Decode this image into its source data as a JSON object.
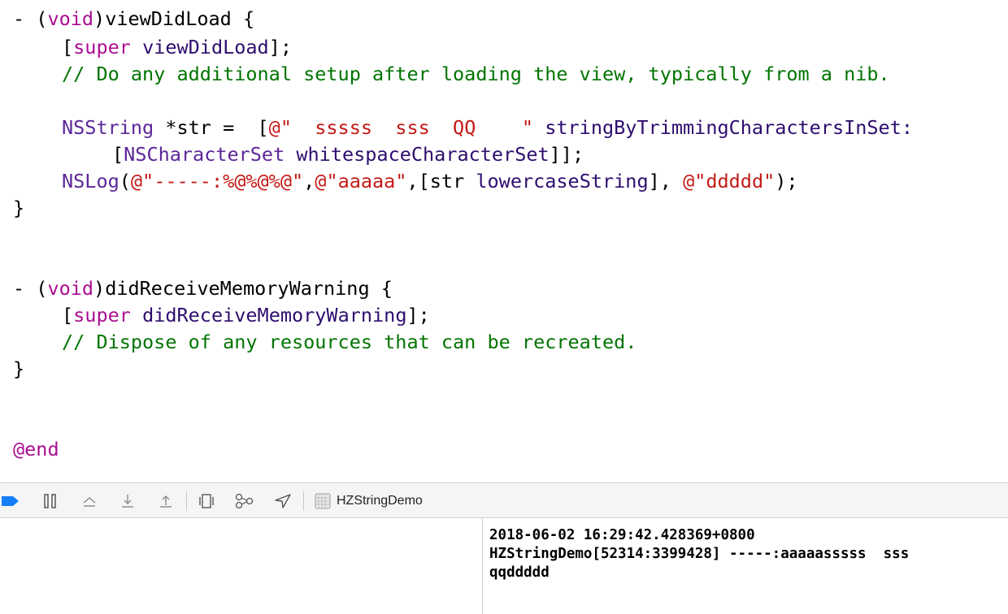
{
  "editor": {
    "viewDidLoad": {
      "sig_dash": "- (",
      "sig_void": "void",
      "sig_name": ")viewDidLoad {",
      "super_open": "[",
      "super_kw": "super",
      "super_call": "viewDidLoad",
      "super_close": "];",
      "comment": "// Do any additional setup after loading the view, typically from a nib.",
      "str_type": "NSString",
      "str_var": " *str =  [",
      "str_literal": "@\"  sssss  sss  QQ    \"",
      "str_sel": " stringByTrimmingCharactersInSet:",
      "cs_open": "[",
      "cs_class": "NSCharacterSet",
      "cs_sel": "whitespaceCharacterSet",
      "cs_close": "]];",
      "log_fn": "NSLog",
      "log_open": "(",
      "log_fmt": "@\"-----:%@%@%@\"",
      "log_comma1": ",",
      "log_arg1": "@\"aaaaa\"",
      "log_comma2": ",[str ",
      "log_sel": "lowercaseString",
      "log_comma3": "], ",
      "log_arg3": "@\"ddddd\"",
      "log_close": ");",
      "close_brace": "}"
    },
    "didReceiveMemoryWarning": {
      "sig_dash": "- (",
      "sig_void": "void",
      "sig_name": ")didReceiveMemoryWarning {",
      "super_open": "[",
      "super_kw": "super",
      "super_call": "didReceiveMemoryWarning",
      "super_close": "];",
      "comment": "// Dispose of any resources that can be recreated.",
      "close_brace": "}"
    },
    "end_directive": "@end"
  },
  "debug_bar": {
    "process_name": "HZStringDemo",
    "icons": [
      "breakpoints-toggle-icon",
      "pause-icon",
      "step-over-icon",
      "step-into-icon",
      "step-out-icon",
      "view-debugger-icon",
      "memory-graph-icon",
      "location-icon",
      "process-icon"
    ]
  },
  "console": {
    "line1": "2018-06-02 16:29:42.428369+0800",
    "line2": "HZStringDemo[52314:3399428] -----:aaaaasssss  sss",
    "line3": "qqddddd"
  },
  "colors": {
    "keyword": "#aa0d91",
    "string": "#c41a16",
    "class": "#5c2699",
    "method": "#2e0d6e",
    "comment": "#007400",
    "breakpoint_blue": "#147efb"
  }
}
